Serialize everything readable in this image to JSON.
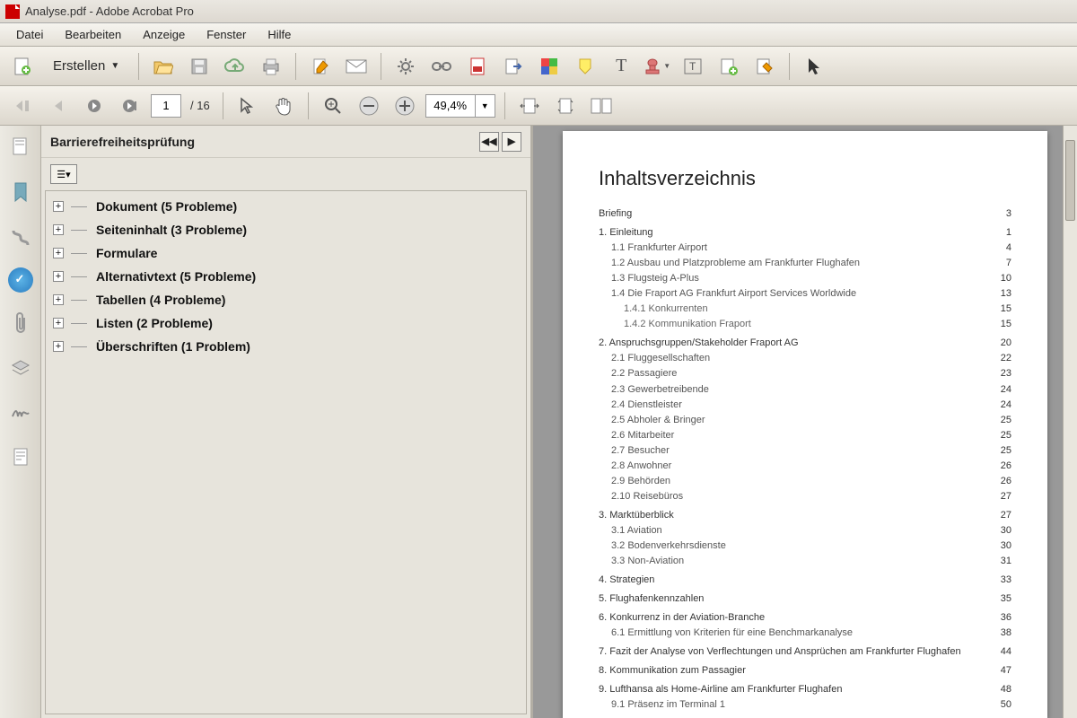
{
  "title": "Analyse.pdf - Adobe Acrobat Pro",
  "menu": [
    "Datei",
    "Bearbeiten",
    "Anzeige",
    "Fenster",
    "Hilfe"
  ],
  "createBtn": "Erstellen",
  "pageCurrent": "1",
  "pageTotal": "/ 16",
  "zoom": "49,4%",
  "panelTitle": "Barrierefreiheitsprüfung",
  "tree": [
    {
      "label": "Dokument (5 Probleme)"
    },
    {
      "label": "Seiteninhalt (3 Probleme)"
    },
    {
      "label": "Formulare"
    },
    {
      "label": "Alternativtext (5 Probleme)"
    },
    {
      "label": "Tabellen (4 Probleme)"
    },
    {
      "label": "Listen (2 Probleme)"
    },
    {
      "label": "Überschriften (1 Problem)"
    }
  ],
  "doc": {
    "heading": "Inhaltsverzeichnis",
    "toc": [
      {
        "lvl": 1,
        "t": "Briefing",
        "p": "3"
      },
      {
        "lvl": 1,
        "t": "1. Einleitung",
        "p": "1"
      },
      {
        "lvl": 2,
        "t": "1.1 Frankfurter Airport",
        "p": "4"
      },
      {
        "lvl": 2,
        "t": "1.2 Ausbau und Platzprobleme am Frankfurter Flughafen",
        "p": "7"
      },
      {
        "lvl": 2,
        "t": "1.3 Flugsteig A-Plus",
        "p": "10"
      },
      {
        "lvl": 2,
        "t": "1.4 Die Fraport AG Frankfurt Airport Services Worldwide",
        "p": "13"
      },
      {
        "lvl": 3,
        "t": "1.4.1 Konkurrenten",
        "p": "15"
      },
      {
        "lvl": 3,
        "t": "1.4.2 Kommunikation Fraport",
        "p": "15"
      },
      {
        "lvl": 1,
        "t": "2. Anspruchsgruppen/Stakeholder Fraport AG",
        "p": "20"
      },
      {
        "lvl": 2,
        "t": "2.1 Fluggesellschaften",
        "p": "22"
      },
      {
        "lvl": 2,
        "t": "2.2 Passagiere",
        "p": "23"
      },
      {
        "lvl": 2,
        "t": "2.3 Gewerbetreibende",
        "p": "24"
      },
      {
        "lvl": 2,
        "t": "2.4 Dienstleister",
        "p": "24"
      },
      {
        "lvl": 2,
        "t": "2.5 Abholer & Bringer",
        "p": "25"
      },
      {
        "lvl": 2,
        "t": "2.6 Mitarbeiter",
        "p": "25"
      },
      {
        "lvl": 2,
        "t": "2.7 Besucher",
        "p": "25"
      },
      {
        "lvl": 2,
        "t": "2.8 Anwohner",
        "p": "26"
      },
      {
        "lvl": 2,
        "t": "2.9 Behörden",
        "p": "26"
      },
      {
        "lvl": 2,
        "t": "2.10 Reisebüros",
        "p": "27"
      },
      {
        "lvl": 1,
        "t": "3. Marktüberblick",
        "p": "27"
      },
      {
        "lvl": 2,
        "t": "3.1 Aviation",
        "p": "30"
      },
      {
        "lvl": 2,
        "t": "3.2 Bodenverkehrsdienste",
        "p": "30"
      },
      {
        "lvl": 2,
        "t": "3.3 Non-Aviation",
        "p": "31"
      },
      {
        "lvl": 1,
        "t": "4. Strategien",
        "p": "33"
      },
      {
        "lvl": 1,
        "t": "5. Flughafenkennzahlen",
        "p": "35"
      },
      {
        "lvl": 1,
        "t": "6. Konkurrenz in der Aviation-Branche",
        "p": "36"
      },
      {
        "lvl": 2,
        "t": "6.1 Ermittlung von Kriterien für eine Benchmarkanalyse",
        "p": "38"
      },
      {
        "lvl": 1,
        "t": "7. Fazit der Analyse von Verflechtungen und Ansprüchen am Frankfurter Flughafen",
        "p": "44"
      },
      {
        "lvl": 1,
        "t": "8. Kommunikation zum Passagier",
        "p": "47"
      },
      {
        "lvl": 1,
        "t": "9. Lufthansa als Home-Airline am Frankfurter Flughafen",
        "p": "48"
      },
      {
        "lvl": 2,
        "t": "9.1 Präsenz im Terminal 1",
        "p": "50"
      }
    ]
  }
}
